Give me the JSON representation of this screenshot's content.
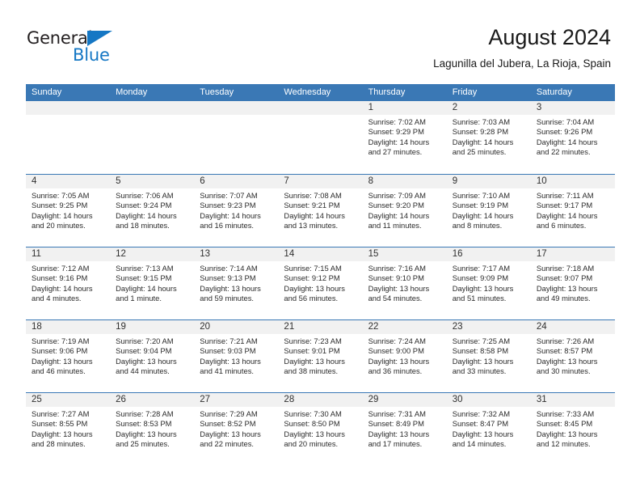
{
  "brand": {
    "name_part1": "General",
    "name_part2": "Blue"
  },
  "header": {
    "title": "August 2024",
    "subtitle": "Lagunilla del Jubera, La Rioja, Spain"
  },
  "weekday_headers": [
    "Sunday",
    "Monday",
    "Tuesday",
    "Wednesday",
    "Thursday",
    "Friday",
    "Saturday"
  ],
  "colors": {
    "header_bar": "#3a78b5",
    "brand_blue": "#1577c4",
    "date_band": "#f1f1f1",
    "week_divider": "#3a78b5"
  },
  "weeks": [
    [
      {
        "date": "",
        "lines": []
      },
      {
        "date": "",
        "lines": []
      },
      {
        "date": "",
        "lines": []
      },
      {
        "date": "",
        "lines": []
      },
      {
        "date": "1",
        "lines": [
          "Sunrise: 7:02 AM",
          "Sunset: 9:29 PM",
          "Daylight: 14 hours and 27 minutes."
        ]
      },
      {
        "date": "2",
        "lines": [
          "Sunrise: 7:03 AM",
          "Sunset: 9:28 PM",
          "Daylight: 14 hours and 25 minutes."
        ]
      },
      {
        "date": "3",
        "lines": [
          "Sunrise: 7:04 AM",
          "Sunset: 9:26 PM",
          "Daylight: 14 hours and 22 minutes."
        ]
      }
    ],
    [
      {
        "date": "4",
        "lines": [
          "Sunrise: 7:05 AM",
          "Sunset: 9:25 PM",
          "Daylight: 14 hours and 20 minutes."
        ]
      },
      {
        "date": "5",
        "lines": [
          "Sunrise: 7:06 AM",
          "Sunset: 9:24 PM",
          "Daylight: 14 hours and 18 minutes."
        ]
      },
      {
        "date": "6",
        "lines": [
          "Sunrise: 7:07 AM",
          "Sunset: 9:23 PM",
          "Daylight: 14 hours and 16 minutes."
        ]
      },
      {
        "date": "7",
        "lines": [
          "Sunrise: 7:08 AM",
          "Sunset: 9:21 PM",
          "Daylight: 14 hours and 13 minutes."
        ]
      },
      {
        "date": "8",
        "lines": [
          "Sunrise: 7:09 AM",
          "Sunset: 9:20 PM",
          "Daylight: 14 hours and 11 minutes."
        ]
      },
      {
        "date": "9",
        "lines": [
          "Sunrise: 7:10 AM",
          "Sunset: 9:19 PM",
          "Daylight: 14 hours and 8 minutes."
        ]
      },
      {
        "date": "10",
        "lines": [
          "Sunrise: 7:11 AM",
          "Sunset: 9:17 PM",
          "Daylight: 14 hours and 6 minutes."
        ]
      }
    ],
    [
      {
        "date": "11",
        "lines": [
          "Sunrise: 7:12 AM",
          "Sunset: 9:16 PM",
          "Daylight: 14 hours and 4 minutes."
        ]
      },
      {
        "date": "12",
        "lines": [
          "Sunrise: 7:13 AM",
          "Sunset: 9:15 PM",
          "Daylight: 14 hours and 1 minute."
        ]
      },
      {
        "date": "13",
        "lines": [
          "Sunrise: 7:14 AM",
          "Sunset: 9:13 PM",
          "Daylight: 13 hours and 59 minutes."
        ]
      },
      {
        "date": "14",
        "lines": [
          "Sunrise: 7:15 AM",
          "Sunset: 9:12 PM",
          "Daylight: 13 hours and 56 minutes."
        ]
      },
      {
        "date": "15",
        "lines": [
          "Sunrise: 7:16 AM",
          "Sunset: 9:10 PM",
          "Daylight: 13 hours and 54 minutes."
        ]
      },
      {
        "date": "16",
        "lines": [
          "Sunrise: 7:17 AM",
          "Sunset: 9:09 PM",
          "Daylight: 13 hours and 51 minutes."
        ]
      },
      {
        "date": "17",
        "lines": [
          "Sunrise: 7:18 AM",
          "Sunset: 9:07 PM",
          "Daylight: 13 hours and 49 minutes."
        ]
      }
    ],
    [
      {
        "date": "18",
        "lines": [
          "Sunrise: 7:19 AM",
          "Sunset: 9:06 PM",
          "Daylight: 13 hours and 46 minutes."
        ]
      },
      {
        "date": "19",
        "lines": [
          "Sunrise: 7:20 AM",
          "Sunset: 9:04 PM",
          "Daylight: 13 hours and 44 minutes."
        ]
      },
      {
        "date": "20",
        "lines": [
          "Sunrise: 7:21 AM",
          "Sunset: 9:03 PM",
          "Daylight: 13 hours and 41 minutes."
        ]
      },
      {
        "date": "21",
        "lines": [
          "Sunrise: 7:23 AM",
          "Sunset: 9:01 PM",
          "Daylight: 13 hours and 38 minutes."
        ]
      },
      {
        "date": "22",
        "lines": [
          "Sunrise: 7:24 AM",
          "Sunset: 9:00 PM",
          "Daylight: 13 hours and 36 minutes."
        ]
      },
      {
        "date": "23",
        "lines": [
          "Sunrise: 7:25 AM",
          "Sunset: 8:58 PM",
          "Daylight: 13 hours and 33 minutes."
        ]
      },
      {
        "date": "24",
        "lines": [
          "Sunrise: 7:26 AM",
          "Sunset: 8:57 PM",
          "Daylight: 13 hours and 30 minutes."
        ]
      }
    ],
    [
      {
        "date": "25",
        "lines": [
          "Sunrise: 7:27 AM",
          "Sunset: 8:55 PM",
          "Daylight: 13 hours and 28 minutes."
        ]
      },
      {
        "date": "26",
        "lines": [
          "Sunrise: 7:28 AM",
          "Sunset: 8:53 PM",
          "Daylight: 13 hours and 25 minutes."
        ]
      },
      {
        "date": "27",
        "lines": [
          "Sunrise: 7:29 AM",
          "Sunset: 8:52 PM",
          "Daylight: 13 hours and 22 minutes."
        ]
      },
      {
        "date": "28",
        "lines": [
          "Sunrise: 7:30 AM",
          "Sunset: 8:50 PM",
          "Daylight: 13 hours and 20 minutes."
        ]
      },
      {
        "date": "29",
        "lines": [
          "Sunrise: 7:31 AM",
          "Sunset: 8:49 PM",
          "Daylight: 13 hours and 17 minutes."
        ]
      },
      {
        "date": "30",
        "lines": [
          "Sunrise: 7:32 AM",
          "Sunset: 8:47 PM",
          "Daylight: 13 hours and 14 minutes."
        ]
      },
      {
        "date": "31",
        "lines": [
          "Sunrise: 7:33 AM",
          "Sunset: 8:45 PM",
          "Daylight: 13 hours and 12 minutes."
        ]
      }
    ]
  ]
}
